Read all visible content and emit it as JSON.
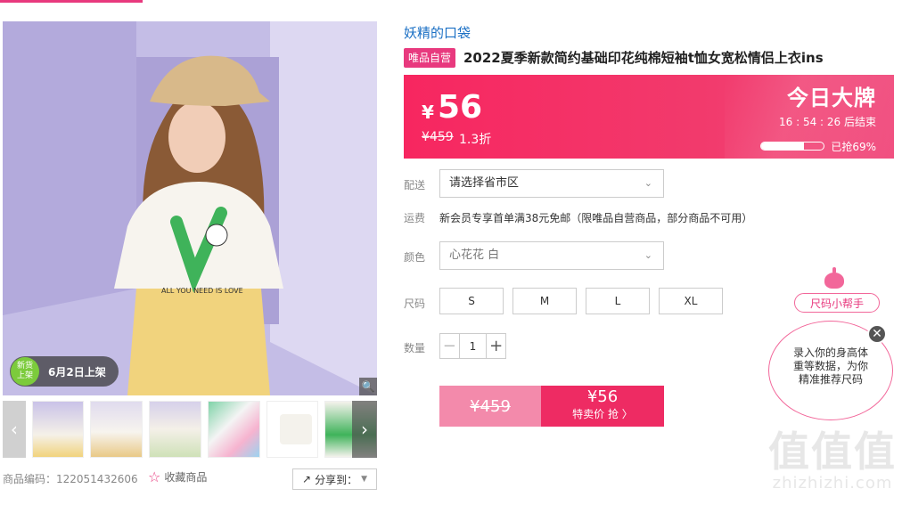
{
  "product": {
    "brand": "妖精的口袋",
    "self_tag": "唯品自营",
    "title": "2022夏季新款简约基础印花纯棉短袖t恤女宽松情侣上衣ins"
  },
  "gallery": {
    "new_badge_circle": "新货\n上架",
    "new_badge_text": "6月2日上架",
    "zoom_icon": "search-icon",
    "tshirt_print_text": "ALL YOU NEED IS LOVE",
    "thumb_count": 6
  },
  "meta": {
    "sku": "商品编码：122051432606",
    "favorite": "收藏商品",
    "share": "分享到："
  },
  "price": {
    "currency": "¥",
    "current": "56",
    "original": "¥459",
    "discount": "1.3折",
    "promo_title": "今日大牌",
    "countdown": "16 : 54 : 26  后结束",
    "sold_label": "已抢69%",
    "sold_fraction": 0.69
  },
  "delivery": {
    "label": "配送",
    "placeholder": "请选择省市区"
  },
  "shipping": {
    "label": "运费",
    "text": "新会员专享首单满38元免邮（限唯品自营商品，部分商品不可用）"
  },
  "color": {
    "label": "颜色",
    "selected": "心花花 白"
  },
  "size": {
    "label": "尺码",
    "options": [
      "S",
      "M",
      "L",
      "XL"
    ]
  },
  "quantity": {
    "label": "数量",
    "value": "1",
    "minus": "−",
    "plus": "+"
  },
  "buy": {
    "original": "¥459",
    "price": "¥56",
    "action": "特卖价 抢 〉"
  },
  "size_helper": {
    "pill": "尺码小帮手",
    "bubble_line1": "录入你的身高体",
    "bubble_line2": "重等数据，为你",
    "bubble_line3": "精准推荐尺码"
  },
  "watermark": {
    "big": "值值值",
    "small": "zhizhizhi.com"
  },
  "colors": {
    "accent": "#e8397e",
    "banner": "#f72660",
    "brand_link": "#1a6fc4"
  }
}
